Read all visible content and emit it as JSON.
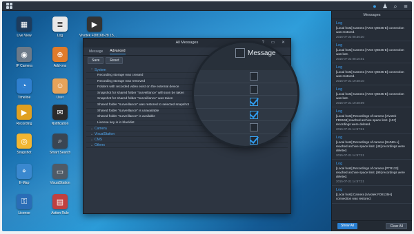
{
  "desktop": {
    "icons": [
      {
        "label": "Live View",
        "glyph": "▦",
        "color": "#1d3b5c"
      },
      {
        "label": "Log",
        "glyph": "≣",
        "color": "#e8e8e8"
      },
      {
        "label": "Vivotek FD8168-28 15...",
        "glyph": "▶",
        "color": "#333333"
      },
      {
        "label": "IP Camera",
        "glyph": "◉",
        "color": "#6c7a89"
      },
      {
        "label": "Add-ons",
        "glyph": "⊕",
        "color": "#e07b2a"
      },
      {
        "label": "Timeline",
        "glyph": "◔",
        "color": "#2f7fcf"
      },
      {
        "label": "User",
        "glyph": "☺",
        "color": "#e6a35a"
      },
      {
        "label": "Recording",
        "glyph": "▶",
        "color": "#e0a020"
      },
      {
        "label": "Notification",
        "glyph": "✉",
        "color": "#2b2b2b"
      },
      {
        "label": "Snapshot",
        "glyph": "◎",
        "color": "#f2b632"
      },
      {
        "label": "Smart Search",
        "glyph": "⌕",
        "color": "#3a4552"
      },
      {
        "label": "E-Map",
        "glyph": "⌖",
        "color": "#3a88cf"
      },
      {
        "label": "VisualStation",
        "glyph": "▭",
        "color": "#4f5a66"
      },
      {
        "label": "License",
        "glyph": "⚿",
        "color": "#2a6db6"
      },
      {
        "label": "Action Rule",
        "glyph": "▤",
        "color": "#c04040"
      }
    ]
  },
  "window": {
    "title": "All Messages",
    "controls": "? ▭ ✕",
    "tabs": [
      "Message",
      "Advanced"
    ],
    "active_tab": "Advanced",
    "buttons": {
      "save": "Save",
      "reset": "Reset"
    },
    "groups": [
      {
        "label": "System",
        "expanded": true,
        "items": [
          {
            "label": "Recording storage was created"
          },
          {
            "label": "Recording storage was removed"
          },
          {
            "label": "Folders with recorded video exist on the external device"
          },
          {
            "label": "Snapshot for shared folder \"surveillance\" will soon be taken"
          },
          {
            "label": "Snapshot for shared folder \"surveillance\" was taken"
          },
          {
            "label": "Shared folder \"surveillance\" was restored to selected snapshot"
          },
          {
            "label": "Shared folder \"surveillance\" is unavailable"
          },
          {
            "label": "Shared folder \"surveillance\" is available"
          },
          {
            "label": "License key is in blacklist"
          }
        ]
      },
      {
        "label": "Camera",
        "expanded": false,
        "items": []
      },
      {
        "label": "VisualStation",
        "expanded": false,
        "items": []
      },
      {
        "label": "CMS",
        "expanded": false,
        "items": []
      },
      {
        "label": "Others",
        "expanded": false,
        "items": []
      }
    ]
  },
  "magnifier": {
    "column_title": "Message",
    "checks": [
      false,
      false,
      true,
      true,
      false,
      true,
      true
    ]
  },
  "panel": {
    "title": "Messages",
    "messages": [
      {
        "title": "Log",
        "body": "[Local host] Camera [AXIS Q6045-E] connection was restored.",
        "time": "2015-07-22 08:36:30"
      },
      {
        "title": "Log",
        "body": "[Local host] Camera [AXIS Q6045-E] connection was lost.",
        "time": "2015-07-22 08:10:01"
      },
      {
        "title": "Log",
        "body": "[Local host] Camera [AXIS Q6045-E] connection was restored.",
        "time": "2015-07-21 19:48:10"
      },
      {
        "title": "Log",
        "body": "[Local host] Camera [AXIS Q6045-E] connection was lost.",
        "time": "2015-07-21 19:48:09"
      },
      {
        "title": "Log",
        "body": "[Local host] Recordings of camera [Vivotek FD8168] reached archive space limit. [157] recordings were deleted.",
        "time": "2015-07-21 14:57:21"
      },
      {
        "title": "Log",
        "body": "[Local host] Recordings of camera [SUNELL] reached archive space limit. [48] recordings were deleted.",
        "time": "2015-07-21 14:57:21"
      },
      {
        "title": "Log",
        "body": "[Local host] Recordings of camera [PTR133] reached archive space limit. [99] recordings were deleted.",
        "time": "2015-07-21 14:57:21"
      },
      {
        "title": "Log",
        "body": "[Local host] Camera [Vivotek FD8135H] connection was restored.",
        "time": ""
      }
    ],
    "show_all": "Show All",
    "clear_all": "Clear All"
  }
}
